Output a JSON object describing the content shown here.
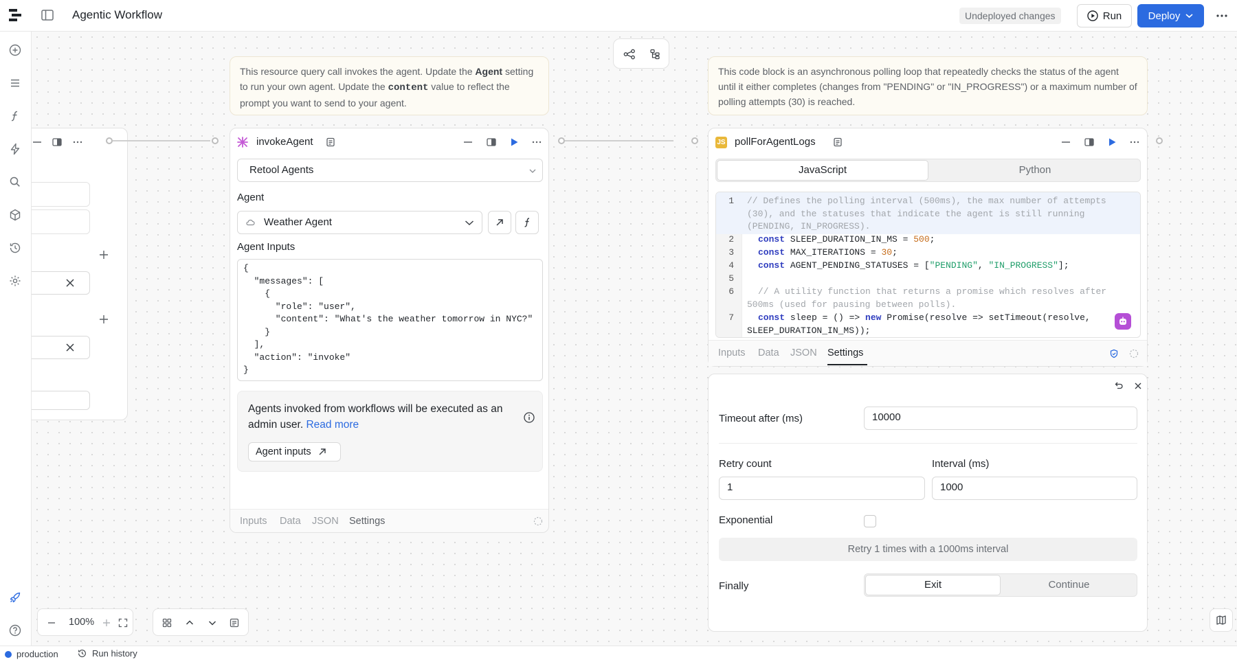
{
  "topbar": {
    "title": "Agentic Workflow",
    "undeployed_label": "Undeployed changes",
    "run_label": "Run",
    "deploy_label": "Deploy"
  },
  "left_rail": {
    "icons": [
      "plus-circle-icon",
      "list-icon",
      "function-icon",
      "lightning-icon",
      "search-icon",
      "cube-icon",
      "history-icon",
      "gear-icon",
      "rocket-icon",
      "help-icon"
    ]
  },
  "notes": {
    "invoke_note": {
      "part1": "This resource query call invokes the agent. Update the ",
      "bold1": "Agent",
      "part2": " setting to run your own agent. Update the ",
      "code1": "content",
      "part3": " value to reflect the prompt you want to send to your agent."
    },
    "poll_note": "This code block is an asynchronous polling loop that repeatedly checks the status of the agent until it either completes (changes from \"PENDING\" or \"IN_PROGRESS\") or a maximum number of polling attempts (30) is reached."
  },
  "invoke_agent": {
    "title": "invokeAgent",
    "resource": "Retool Agents",
    "agent_label": "Agent",
    "agent_value": "Weather Agent",
    "agent_inputs_label": "Agent Inputs",
    "agent_inputs_json": "{\n  \"messages\": [\n    {\n      \"role\": \"user\",\n      \"content\": \"What's the weather tomorrow in NYC?\"\n    }\n  ],\n  \"action\": \"invoke\"\n}",
    "info_text": "Agents invoked from workflows will be executed as an admin user.",
    "read_more": "Read more",
    "agent_inputs_button": "Agent inputs",
    "tabs": [
      "Inputs",
      "Data",
      "JSON",
      "Settings"
    ]
  },
  "poll_for_agent_logs": {
    "title": "pollForAgentLogs",
    "lang_tabs": [
      "JavaScript",
      "Python"
    ],
    "active_lang": "JavaScript",
    "tabs": [
      "Inputs",
      "Data",
      "JSON",
      "Settings"
    ],
    "active_tab": "Settings",
    "code_lines": [
      {
        "num": "1",
        "text": "// Defines the polling interval (500ms), the max number of attempts\n(30), and the statuses that indicate the agent is still running\n(PENDING, IN_PROGRESS)."
      },
      {
        "num": "2",
        "text": "const SLEEP_DURATION_IN_MS = 500;"
      },
      {
        "num": "3",
        "text": "const MAX_ITERATIONS = 30;"
      },
      {
        "num": "4",
        "text": "const AGENT_PENDING_STATUSES = [\"PENDING\", \"IN_PROGRESS\"];"
      },
      {
        "num": "5",
        "text": ""
      },
      {
        "num": "6",
        "text": "// A utility function that returns a promise which resolves after\n500ms (used for pausing between polls)."
      },
      {
        "num": "7",
        "text": "const sleep = () => new Promise(resolve => setTimeout(resolve,\nSLEEP_DURATION_IN_MS));"
      }
    ],
    "settings": {
      "timeout_label": "Timeout after (ms)",
      "timeout_value": "10000",
      "retry_count_label": "Retry count",
      "retry_count_value": "1",
      "interval_label": "Interval (ms)",
      "interval_value": "1000",
      "exponential_label": "Exponential",
      "exponential_checked": false,
      "retry_summary": "Retry 1 times with a 1000ms interval",
      "finally_label": "Finally",
      "finally_options": [
        "Exit",
        "Continue"
      ],
      "finally_selected": "Exit"
    }
  },
  "canvas_controls": {
    "zoom": "100%"
  },
  "statusbar": {
    "environment": "production",
    "run_history": "Run history"
  }
}
